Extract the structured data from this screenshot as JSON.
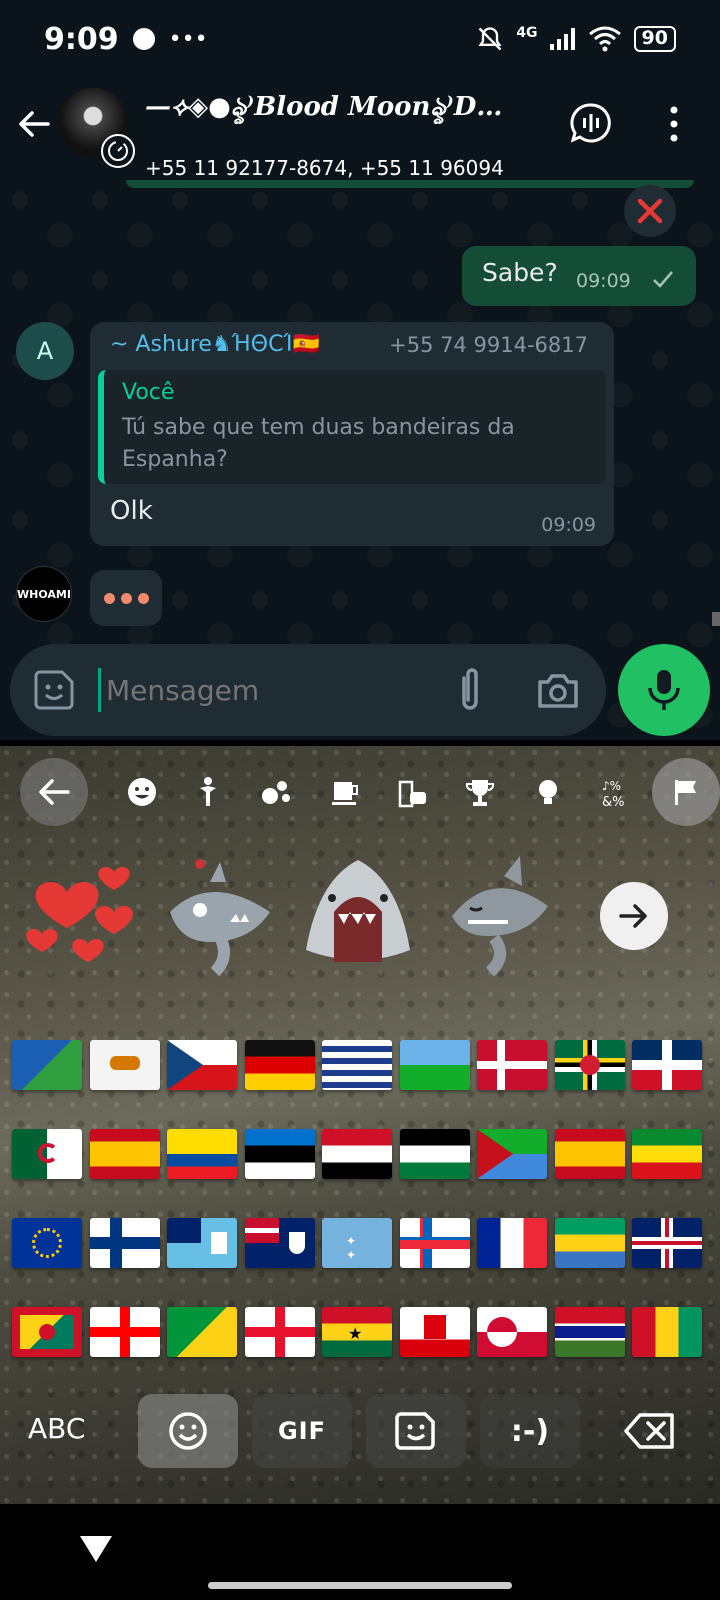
{
  "status_bar": {
    "time": "9:09",
    "network": "4G",
    "battery": "90"
  },
  "header": {
    "group_name": "—⟡◈●ৡ⁾Blood Moonৡ⁾D…",
    "participants": "+55 11 92177-8674, +55 11 96094"
  },
  "chat": {
    "outgoing": {
      "text": "Sabe?",
      "time": "09:09"
    },
    "incoming": {
      "avatar_letter": "A",
      "sender": "~ Ashure♞ΉΘCΊ🇪🇸",
      "phone": "+55 74 9914-6817",
      "quote_author": "Você",
      "quote_text": "Tú sabe que tem duas bandeiras da Espanha?",
      "text": "Olk",
      "time": "09:09"
    },
    "typing_avatar_text": "WHOAMI"
  },
  "input": {
    "placeholder": "Mensagem"
  },
  "keyboard": {
    "categories": [
      "smiley-icon",
      "person-icon",
      "animal-icon",
      "food-icon",
      "travel-icon",
      "trophy-icon",
      "bulb-icon",
      "symbols-icon",
      "flag-icon"
    ],
    "stickers": [
      "hearts-sticker",
      "robot-shark-sticker",
      "shark-face-sticker",
      "sleepy-shark-sticker"
    ],
    "flags": [
      "Christmas Island",
      "Cyprus",
      "Czechia",
      "Germany",
      "British Indian Ocean Territory",
      "Djibouti",
      "Denmark",
      "Dominica",
      "Dominican Republic",
      "Algeria",
      "Ceuta & Melilla",
      "Ecuador",
      "Estonia",
      "Egypt",
      "Western Sahara",
      "Eritrea",
      "Spain",
      "Ethiopia",
      "European Union",
      "Finland",
      "Fiji",
      "Falkland Islands",
      "Micronesia",
      "Faroe Islands",
      "France",
      "Gabon",
      "United Kingdom",
      "Grenada",
      "Georgia",
      "French Guiana",
      "Guernsey",
      "Ghana",
      "Gibraltar",
      "Greenland",
      "Gambia",
      "Guinea"
    ],
    "abc_label": "ABC",
    "gif_label": "GIF",
    "emoticon_label": ":-)"
  }
}
